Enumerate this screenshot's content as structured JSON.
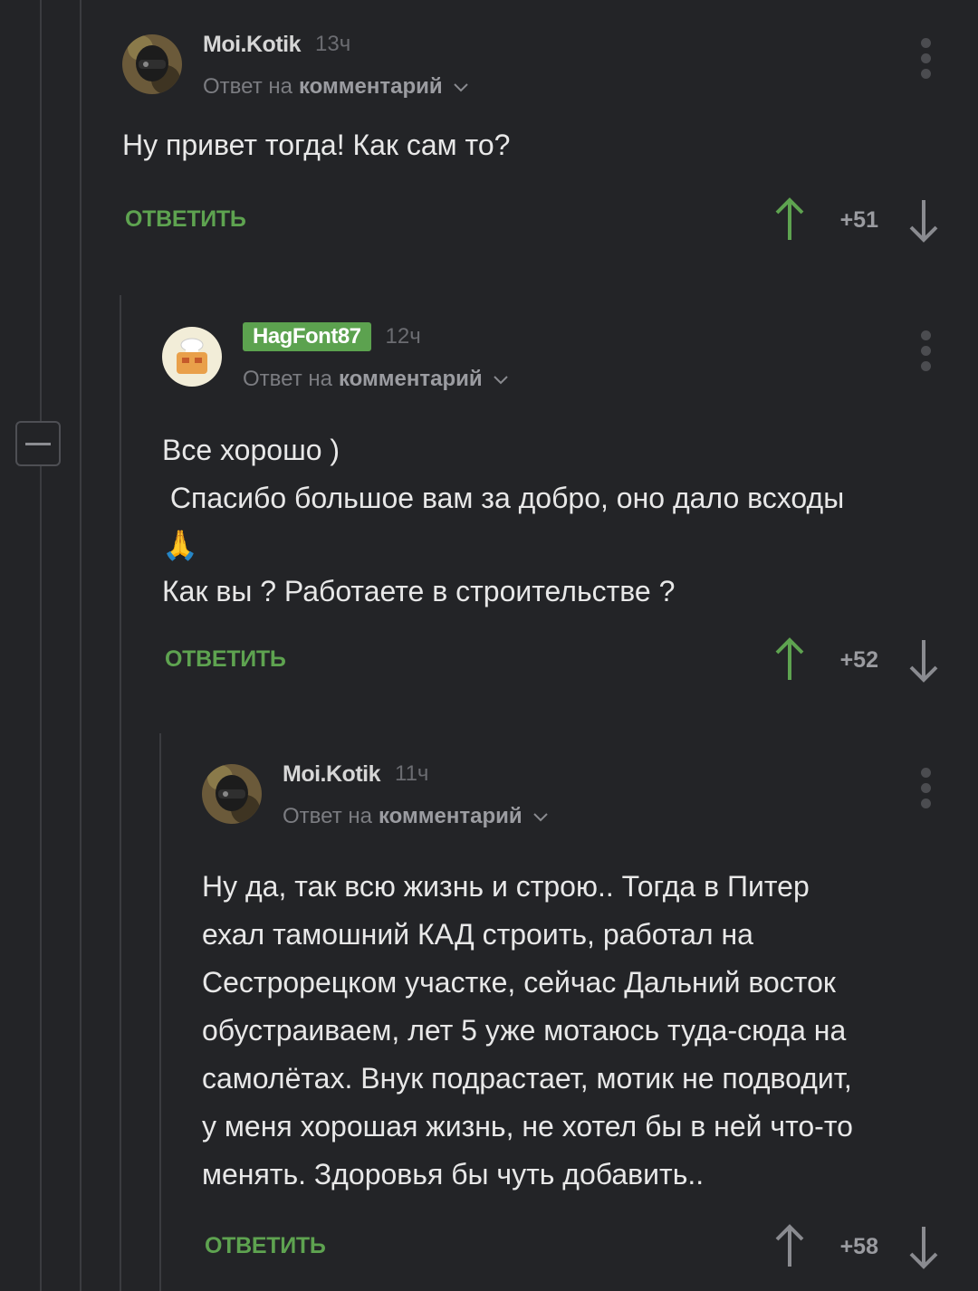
{
  "comments": [
    {
      "author": "Moi.Kotik",
      "time": "13ч",
      "reply_prefix": "Ответ на",
      "reply_target": "комментарий",
      "body": [
        "Ну привет тогда! Как сам то?"
      ],
      "reply_label": "ОТВЕТИТЬ",
      "score": "+51"
    },
    {
      "author": "HagFont87",
      "time": "12ч",
      "reply_prefix": "Ответ на",
      "reply_target": "комментарий",
      "body": [
        "Все хорошо )",
        " Спасибо большое вам за добро, оно дало всходы",
        "🙏",
        "Как вы ? Работаете в строительстве ?"
      ],
      "reply_label": "ОТВЕТИТЬ",
      "score": "+52"
    },
    {
      "author": "Moi.Kotik",
      "time": "11ч",
      "reply_prefix": "Ответ на",
      "reply_target": "комментарий",
      "body": [
        "Ну да, так всю жизнь и строю.. Тогда в Питер",
        "ехал тамошний КАД строить, работал на",
        "Сестрорецком участке, сейчас Дальний восток",
        "обустраиваем, лет 5 уже мотаюсь туда-сюда на",
        "самолётах. Внук подрастает, мотик не подводит,",
        "у меня хорошая жизнь, не хотел бы в ней что-то",
        "менять. Здоровья бы чуть добавить.."
      ],
      "reply_label": "ОТВЕТИТЬ",
      "score": "+58"
    }
  ],
  "colors": {
    "background": "#232427",
    "reply_green": "#5ea350",
    "upvote_green": "#5ea350",
    "badge_green": "#5ca24f"
  },
  "icons": [
    "collapse-icon",
    "menu-dots-icon",
    "upvote-arrow-icon",
    "downvote-arrow-icon",
    "chevron-down-icon",
    "pray-hands-emoji"
  ]
}
